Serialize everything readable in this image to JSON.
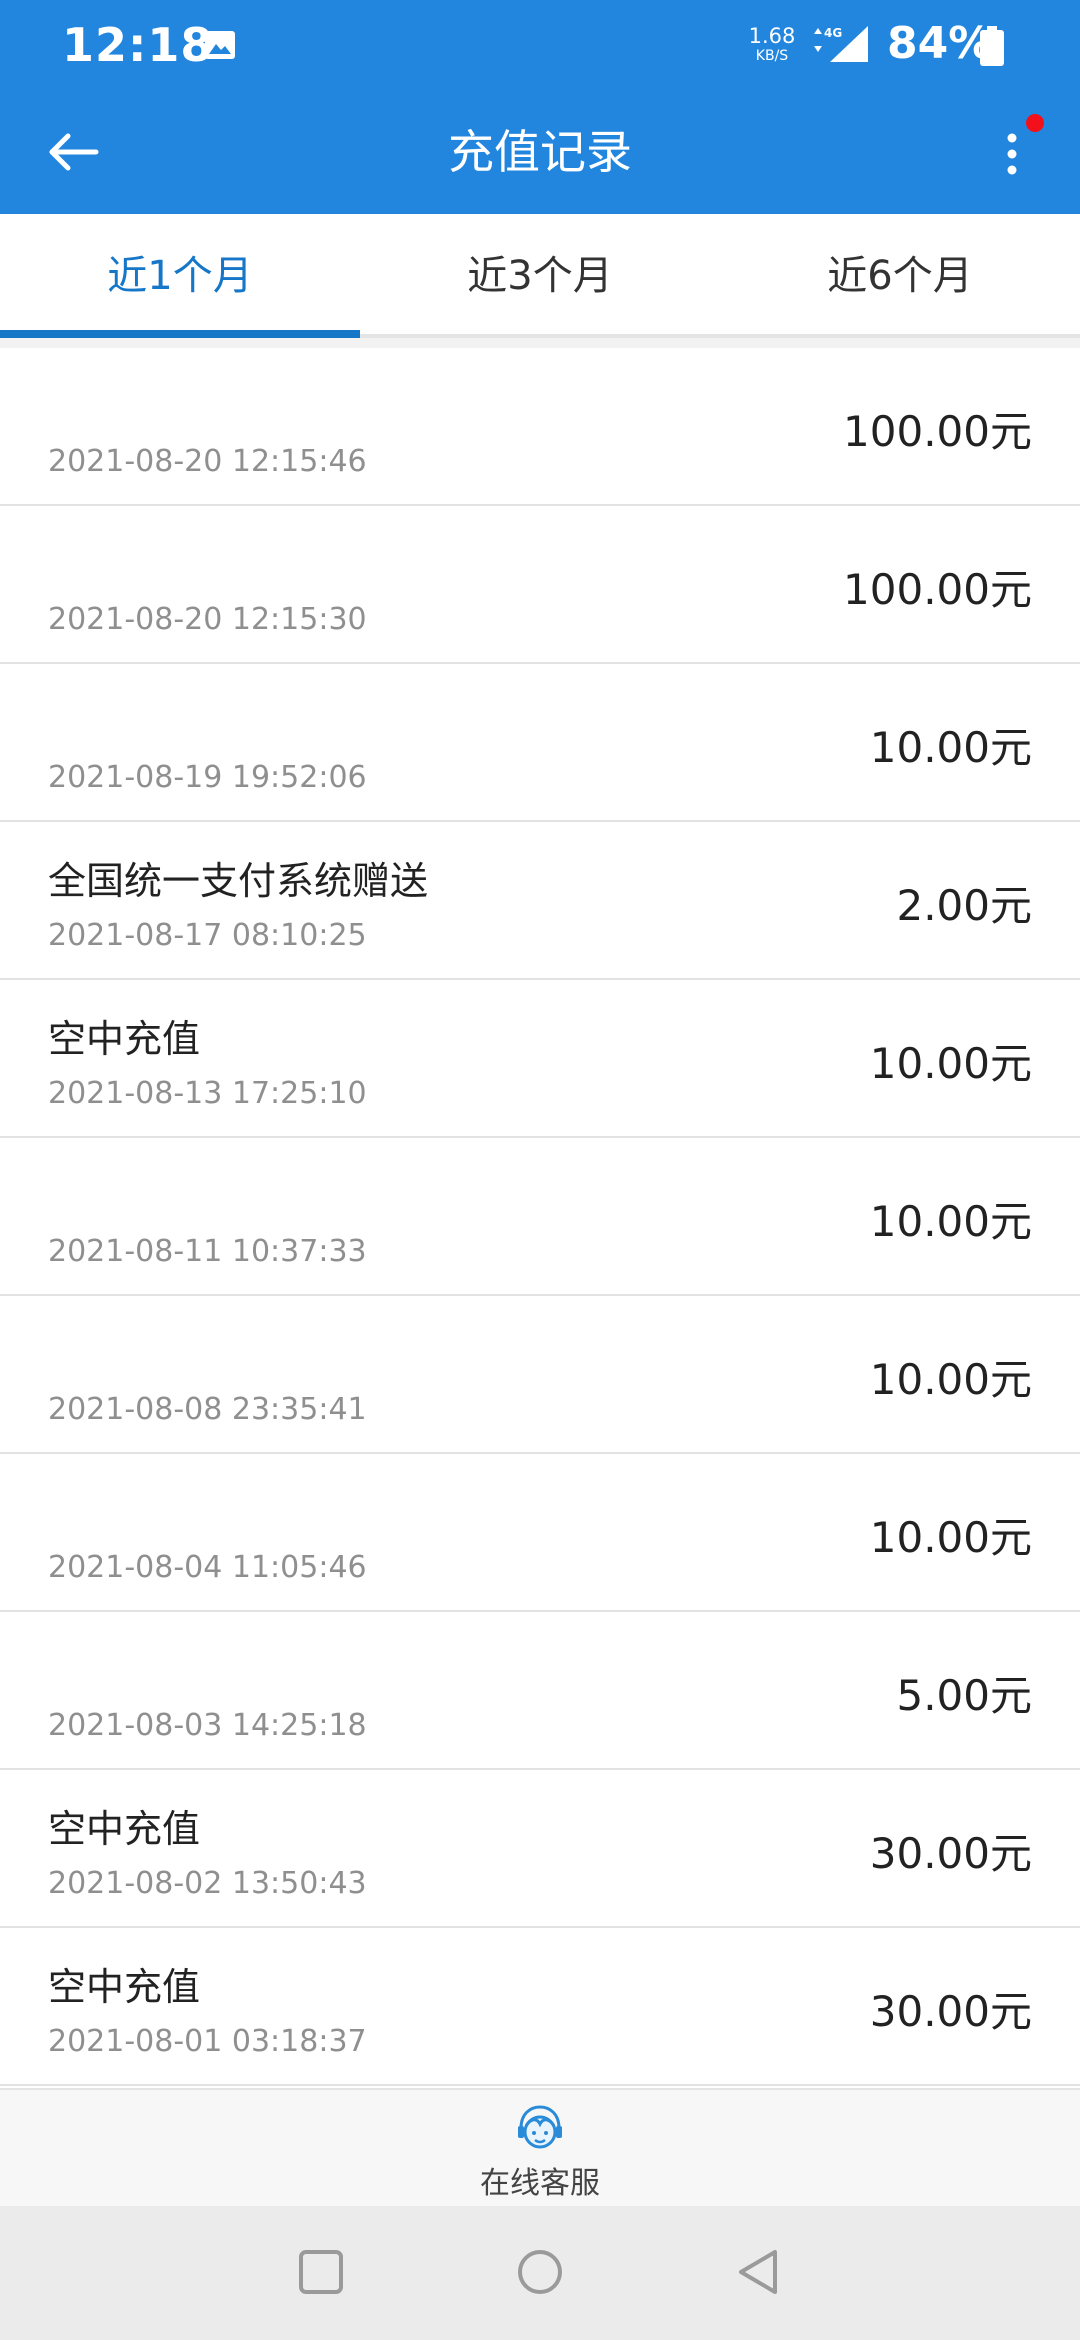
{
  "status_bar": {
    "time": "12:18",
    "net_speed_value": "1.68",
    "net_speed_unit": "KB/S",
    "battery": "84%"
  },
  "app_bar": {
    "title": "充值记录"
  },
  "tabs": [
    {
      "label": "近1个月",
      "active": true
    },
    {
      "label": "近3个月",
      "active": false
    },
    {
      "label": "近6个月",
      "active": false
    }
  ],
  "records": [
    {
      "title": "",
      "date": "2021-08-20 12:15:46",
      "amount": "100.00元"
    },
    {
      "title": "",
      "date": "2021-08-20 12:15:30",
      "amount": "100.00元"
    },
    {
      "title": "",
      "date": "2021-08-19 19:52:06",
      "amount": "10.00元"
    },
    {
      "title": "全国统一支付系统赠送",
      "date": "2021-08-17 08:10:25",
      "amount": "2.00元"
    },
    {
      "title": "空中充值",
      "date": "2021-08-13 17:25:10",
      "amount": "10.00元"
    },
    {
      "title": "",
      "date": "2021-08-11 10:37:33",
      "amount": "10.00元"
    },
    {
      "title": "",
      "date": "2021-08-08 23:35:41",
      "amount": "10.00元"
    },
    {
      "title": "",
      "date": "2021-08-04 11:05:46",
      "amount": "10.00元"
    },
    {
      "title": "",
      "date": "2021-08-03 14:25:18",
      "amount": "5.00元"
    },
    {
      "title": "空中充值",
      "date": "2021-08-02 13:50:43",
      "amount": "30.00元"
    },
    {
      "title": "空中充值",
      "date": "2021-08-01 03:18:37",
      "amount": "30.00元"
    }
  ],
  "service": {
    "label": "在线客服"
  },
  "colors": {
    "primary": "#2286de",
    "tab_active": "#1677c9",
    "notification": "#f2101a"
  }
}
